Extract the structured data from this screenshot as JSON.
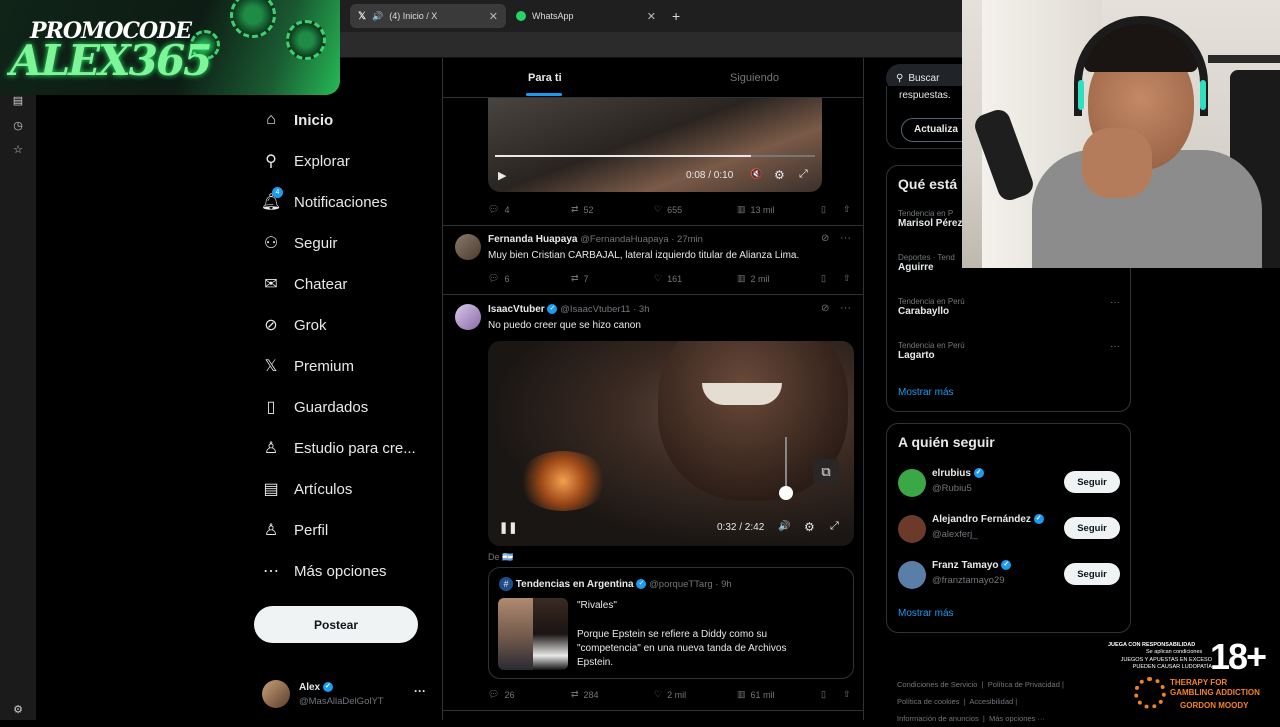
{
  "browser": {
    "tabs": [
      {
        "label": "(4) Inicio / X",
        "icon": "x-logo-icon",
        "active": true
      },
      {
        "label": "WhatsApp",
        "icon": "whatsapp-icon",
        "active": false
      }
    ],
    "new_tab": "+"
  },
  "promo": {
    "line1": "PROMOCODE",
    "line2": "ALEX365"
  },
  "nav": {
    "items": [
      {
        "label": "Inicio",
        "icon": "home-icon",
        "bold": true
      },
      {
        "label": "Explorar",
        "icon": "search-icon"
      },
      {
        "label": "Notificaciones",
        "icon": "bell-icon",
        "badge": "4"
      },
      {
        "label": "Seguir",
        "icon": "add-user-icon"
      },
      {
        "label": "Chatear",
        "icon": "mail-icon"
      },
      {
        "label": "Grok",
        "icon": "grok-icon"
      },
      {
        "label": "Premium",
        "icon": "x-logo-icon"
      },
      {
        "label": "Guardados",
        "icon": "bookmark-icon"
      },
      {
        "label": "Estudio para cre...",
        "icon": "studio-icon"
      },
      {
        "label": "Artículos",
        "icon": "article-icon"
      },
      {
        "label": "Perfil",
        "icon": "person-icon"
      },
      {
        "label": "Más opciones",
        "icon": "more-circle-icon"
      }
    ],
    "post_button": "Postear",
    "account": {
      "name": "Alex",
      "handle": "@MasAllaDelGolYT",
      "more": "···"
    }
  },
  "feed": {
    "tabs": [
      "Para ti",
      "Siguiendo"
    ],
    "tweets": [
      {
        "video": {
          "time": "0:08 / 0:10",
          "progress": 0.8
        },
        "stats": {
          "replies": "4",
          "retweets": "52",
          "likes": "655",
          "views": "13 mil"
        }
      },
      {
        "name": "Fernanda Huapaya",
        "handle": "@FernandaHuapaya · 27min",
        "text": "Muy bien Cristian CARBAJAL, lateral izquierdo titular de Alianza Lima.",
        "stats": {
          "replies": "6",
          "retweets": "7",
          "likes": "161",
          "views": "2 mil"
        }
      },
      {
        "name": "IsaacVtuber",
        "handle": "@IsaacVtuber11 · 3h",
        "text": "No puedo creer que se hizo canon",
        "video": {
          "time": "0:32 / 2:42",
          "progress": 0.2
        },
        "from_label": "De",
        "quote": {
          "name": "Tendencias en Argentina",
          "handle": "@porqueTTarg · 9h",
          "title": "\"Rivales\"",
          "body": "Porque Epstein se refiere a Diddy como su \"competencia\" en una nueva tanda de Archivos Epstein."
        },
        "stats": {
          "replies": "26",
          "retweets": "284",
          "likes": "2 mil",
          "views": "61 mil"
        }
      }
    ]
  },
  "right": {
    "search_placeholder": "Buscar",
    "premium_snippet": "respuestas.",
    "update_button": "Actualiza",
    "trends_title": "Qué está",
    "trends": [
      {
        "category": "Tendencia en P",
        "name": "Marisol Pérez"
      },
      {
        "category": "Deportes · Tend",
        "name": "Aguirre"
      },
      {
        "category": "Tendencia en Perú",
        "name": "Carabayllo"
      },
      {
        "category": "Tendencia en Perú",
        "name": "Lagarto"
      }
    ],
    "show_more": "Mostrar más",
    "who_to_follow_title": "A quién seguir",
    "follow": [
      {
        "name": "elrubius",
        "handle": "@Rubiu5",
        "button": "Seguir",
        "color": "#3aa845"
      },
      {
        "name": "Alejandro Fernández",
        "handle": "@alexferj_",
        "button": "Seguir",
        "color": "#6b3a2a"
      },
      {
        "name": "Franz Tamayo",
        "handle": "@franztamayo29",
        "button": "Seguir",
        "color": "#5a7ea8"
      }
    ],
    "show_more_2": "Mostrar más",
    "footer": [
      "Condiciones de Servicio",
      "Política de Privacidad",
      "Política de cookies",
      "Accesibilidad",
      "Información de anuncios",
      "Más opciones ···"
    ]
  },
  "overlay": {
    "play_responsibly": "JUEGA CON RESPONSABILIDAD",
    "conditions": "Se aplican condiciones",
    "warning": "JUEGOS Y APUESTAS EN EXCESO PUEDEN CAUSAR LUDOPATÍA",
    "age": "18+",
    "therapy": "THERAPY FOR GAMBLING ADDICTION",
    "gordon": "GORDON MOODY"
  },
  "colors": {
    "accent": "#1d9bf0",
    "bg": "#000000",
    "border": "#2f3336",
    "promo_green": "#7ff59a"
  }
}
